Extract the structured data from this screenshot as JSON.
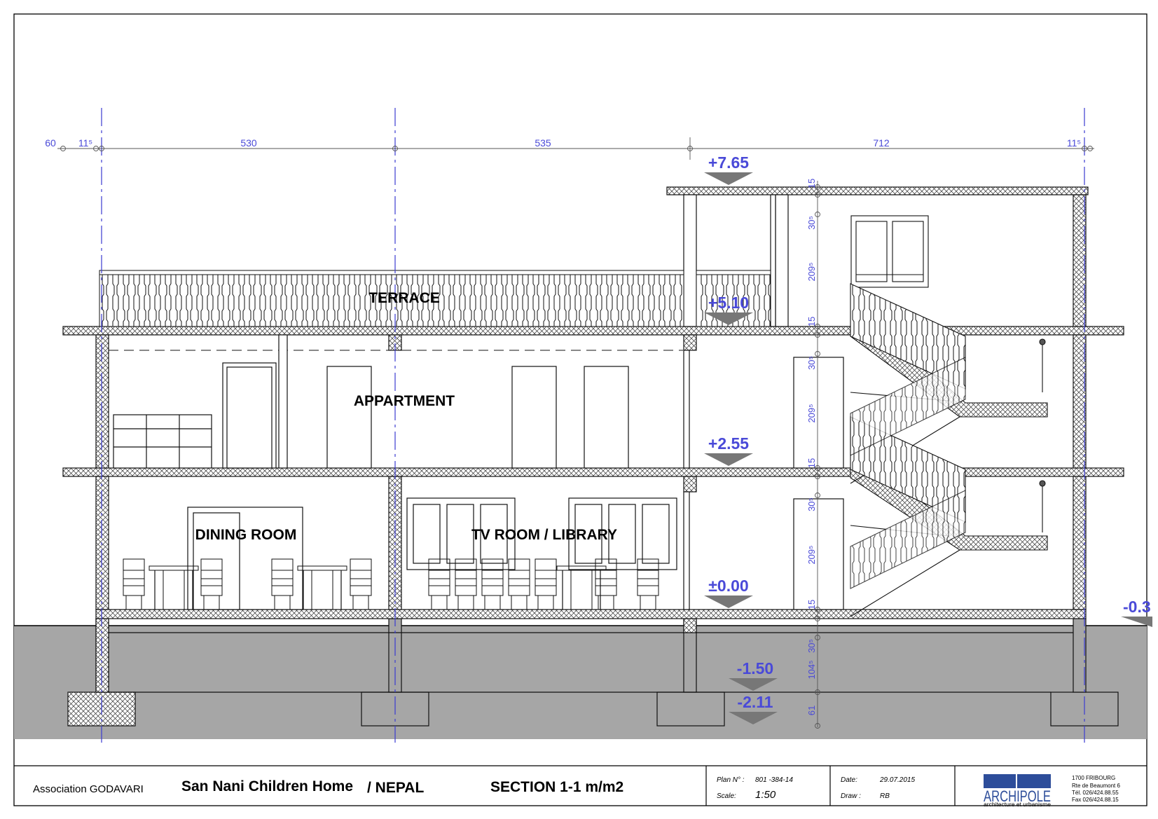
{
  "drawing": {
    "rooms": {
      "terrace": "TERRACE",
      "apartment": "APPARTMENT",
      "dining": "DINING ROOM",
      "tv": "TV ROOM / LIBRARY"
    },
    "levels": {
      "roof": "+7.65",
      "terrace": "+5.10",
      "first": "+2.55",
      "ground": "±0.00",
      "outside": "-0.3",
      "foundation": "-1.50",
      "footing": "-2.11"
    },
    "dimensions_horizontal": [
      "60",
      "11⁵",
      "530",
      "535",
      "712",
      "11⁵"
    ],
    "dimensions_vertical": [
      "15",
      "30⁵",
      "209⁵",
      "15",
      "30⁵",
      "209⁵",
      "15",
      "30⁵",
      "209⁵",
      "15",
      "30⁵",
      "104⁵",
      "61"
    ]
  },
  "title_block": {
    "client": "Association GODAVARI",
    "project": "San Nani Children Home",
    "country": "/ NEPAL",
    "sheet_title": "SECTION 1-1 m/m2",
    "plan_label": "Plan N° :",
    "plan_value": "801  -384-14",
    "scale_label": "Scale:",
    "scale_value": "1:50",
    "date_label": "Date:",
    "date_value": "29.07.2015",
    "draw_label": "Draw :",
    "draw_value": "RB",
    "logo_text": "ARCHIPOLE",
    "logo_tagline": "architecture et urbanisme",
    "address": [
      "1700   FRIBOURG",
      "Rte de Beaumont 6",
      "Tél.  026/424.88.55",
      "Fax  026/424.88.15"
    ]
  }
}
